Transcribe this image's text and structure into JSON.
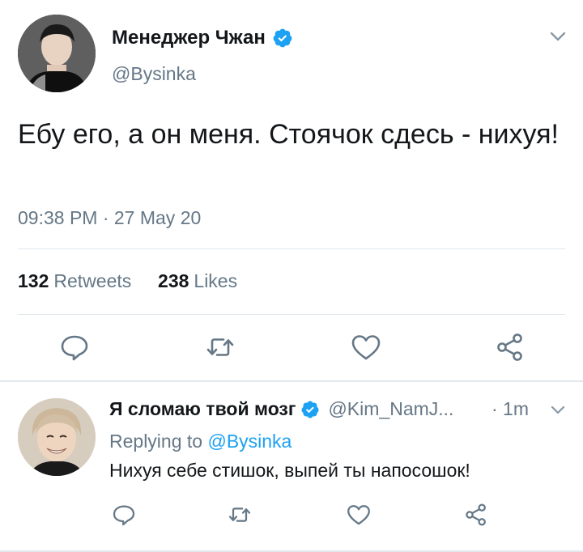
{
  "main_tweet": {
    "author_name": "Менеджер Чжан",
    "author_handle": "@Bysinka",
    "text": "Ебу его, а он меня. Стоячок сдесь - нихуя!",
    "timestamp": "09:38 PM · 27 May 20",
    "retweets_count": "132",
    "retweets_label": "Retweets",
    "likes_count": "238",
    "likes_label": "Likes",
    "verified": true
  },
  "reply_tweet": {
    "author_name": "Я сломаю твой мозг",
    "author_handle": "@Kim_NamJ...",
    "time": "· 1m",
    "replying_prefix": "Replying to",
    "replying_handle": "@Bysinka",
    "text": "Нихуя себе стишок, выпей ты напосошок!",
    "verified": true
  },
  "icons": {
    "reply": "reply-icon",
    "retweet": "retweet-icon",
    "like": "heart-icon",
    "share": "share-icon",
    "menu": "chevron-down-icon",
    "verified": "verified-badge-icon"
  },
  "colors": {
    "text_primary": "#14171a",
    "text_secondary": "#657786",
    "accent": "#1da1f2",
    "divider": "#e1e8ed"
  }
}
